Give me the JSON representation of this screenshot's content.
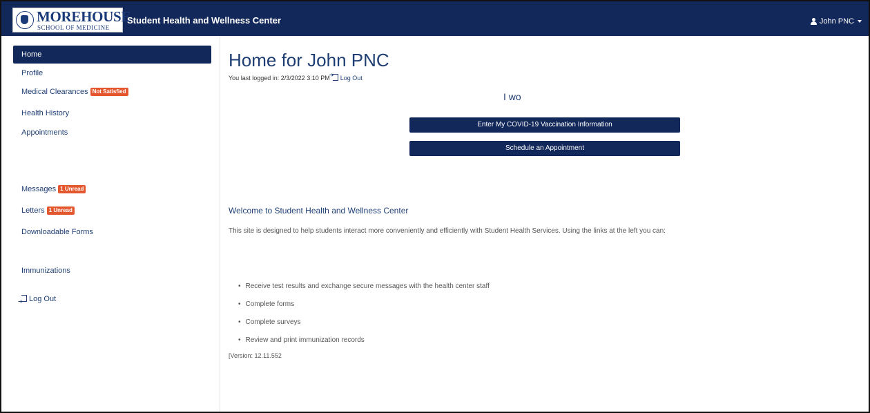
{
  "header": {
    "logo_line1": "MOREHOUSE",
    "logo_line2": "SCHOOL OF MEDICINE",
    "title": "Student Health and Wellness Center",
    "user_name": "John PNC"
  },
  "sidebar": {
    "items": [
      {
        "label": "Home"
      },
      {
        "label": "Profile"
      },
      {
        "label": "Medical Clearances",
        "badge": "Not Satisfied"
      },
      {
        "label": "Health History"
      },
      {
        "label": "Appointments"
      },
      {
        "label": "Messages",
        "badge": "1 Unread"
      },
      {
        "label": "Letters",
        "badge": "1 Unread"
      },
      {
        "label": "Downloadable Forms"
      },
      {
        "label": "Immunizations"
      },
      {
        "label": "Log Out"
      }
    ]
  },
  "main": {
    "heading": "Home for John PNC",
    "last_login_text": "You last logged in: 2/3/2022 3:10 PM",
    "logout_link": "Log Out",
    "notice": "I wo",
    "buttons": {
      "covid": "Enter My COVID-19 Vaccination Information",
      "schedule": "Schedule an Appointment"
    },
    "welcome_title": "Welcome to Student Health and Wellness Center",
    "welcome_text": "This site is designed to help students interact more conveniently and efficiently with Student Health Services. Using the links at the left you can:",
    "bullets": [
      "Receive test results and exchange secure messages with the health center staff",
      "Complete forms",
      "Complete surveys",
      "Review and print immunization records"
    ],
    "version": "[Version: 12.11.552"
  },
  "colors": {
    "navbar": "#12285a",
    "accent_text": "#1f3f74",
    "badge": "#e4572e"
  }
}
